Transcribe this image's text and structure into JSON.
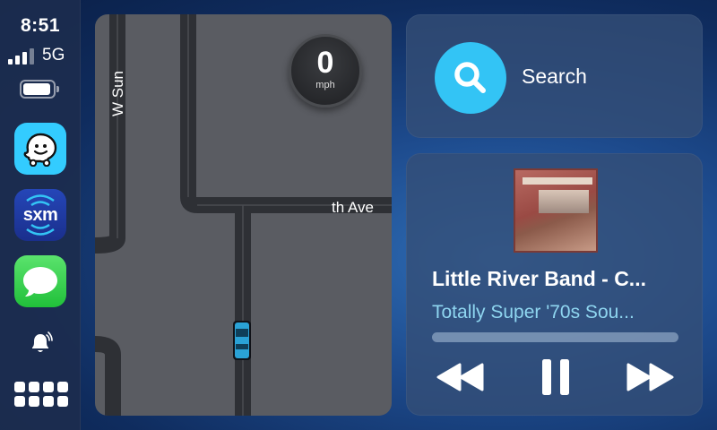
{
  "status": {
    "time": "8:51",
    "network": "5G",
    "signal_bars_filled": 3,
    "signal_bars_total": 4
  },
  "dock": {
    "apps": [
      {
        "name": "Waze",
        "icon": "waze-icon",
        "color": "#33ccff"
      },
      {
        "name": "SiriusXM",
        "label": "sxm",
        "icon": "siriusxm-icon",
        "color": "#2546b8"
      },
      {
        "name": "Messages",
        "icon": "messages-icon",
        "color": "#21c03a"
      }
    ],
    "notification_icon": "bell-icon",
    "app_grid_icon": "app-grid-icon"
  },
  "map": {
    "street_vertical": "W Sun",
    "street_horizontal": "th Ave",
    "speed_value": "0",
    "speed_unit": "mph"
  },
  "search": {
    "label": "Search",
    "icon": "search-icon",
    "accent": "#33c4f5"
  },
  "now_playing": {
    "title": "Little River Band - C...",
    "subtitle": "Totally Super '70s Sou...",
    "progress": 0.0,
    "controls": [
      "rewind-icon",
      "pause-icon",
      "fast-forward-icon"
    ],
    "subtitle_color": "#8fd6f0"
  }
}
